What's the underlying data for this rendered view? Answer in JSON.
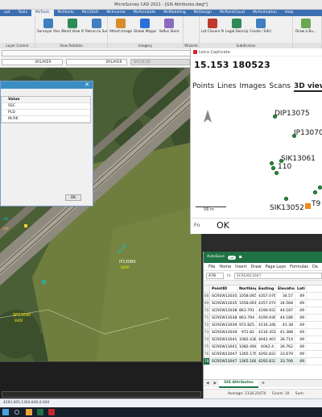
{
  "window": {
    "title": "MicroSurvey CAD 2021 - [GIS Attributes.dwg*]"
  },
  "menu": [
    "out",
    "Tools",
    "MsTools",
    "McPoints",
    "McCOGO",
    "McInverse",
    "McAnnotate",
    "McModeling",
    "McDesign",
    "McPointCloud",
    "McAnimation",
    "Help"
  ],
  "ribbon": {
    "groups": [
      {
        "label": "Layer Control",
        "buttons": []
      },
      {
        "label": "View Rotation",
        "buttons": [
          "Surveyor View",
          "World View (North Up)",
          "Return to Surveyor View"
        ]
      },
      {
        "label": "Imagery",
        "buttons": [
          "Attach Imagery",
          "Global Mapper Auto-Regen",
          "VaRus Store"
        ]
      },
      {
        "label": "Wizards",
        "buttons": []
      },
      {
        "label": "Subdivision",
        "buttons": [
          "Lot Closure Program",
          "Legal Description Writer",
          "Create / Edit Lots Blocks"
        ]
      },
      {
        "label": "",
        "buttons": [
          "Draw a Bu..."
        ]
      }
    ]
  },
  "layerbar": {
    "linetype1": "BYLAYER",
    "linetype2": "BYLAYER",
    "color": "BYCOLOR"
  },
  "dialog": {
    "column_header": "Value",
    "rows": [
      "SSC",
      "PLD",
      "IN RK"
    ],
    "ok_label": "OK"
  },
  "map_labels": [
    {
      "text": "IP13089",
      "sub": "SVOF"
    },
    {
      "text": "SP13090",
      "sub": "SVOF"
    },
    {
      "text": "40.398",
      "sub": ""
    }
  ],
  "leica": {
    "title": "Leica Captivate",
    "position": "15.153 180523",
    "tabs": [
      "Points",
      "Lines",
      "Images",
      "Scans",
      "3D view"
    ],
    "active_tab": "3D view",
    "points": [
      "DIP13075",
      "IP13070",
      "SIK13061",
      "110",
      "SIK13052",
      "T9"
    ],
    "scale_label": "58 m",
    "fn_label": "Fn",
    "ok_label": "OK"
  },
  "excel": {
    "autosave": "AutoSave",
    "autosave_state": "Off",
    "menu": [
      "File",
      "Home",
      "Insert",
      "Draw",
      "Page Layo",
      "Formulas",
      "Da"
    ],
    "cell_ref": "A78",
    "formula_value": "SCREW13047",
    "headers": [
      "PointID",
      "Northing",
      "Easting",
      "Elevation",
      "Lati"
    ],
    "rows": [
      {
        "n": "68",
        "cells": [
          "SCREW13035",
          "1058.065",
          "4357.076",
          "34.57",
          "49"
        ]
      },
      {
        "n": "69",
        "cells": [
          "SCREW13035B",
          "1058.061",
          "4357.074",
          "34.568",
          "49"
        ]
      },
      {
        "n": "70",
        "cells": [
          "SCREW13038",
          "863.791",
          "4190.933",
          "44.187",
          "49"
        ]
      },
      {
        "n": "71",
        "cells": [
          "SCREW13038B",
          "863.794",
          "4190.936",
          "44.186",
          "49"
        ]
      },
      {
        "n": "72",
        "cells": [
          "SCREW13039",
          "972.825",
          "4116.348",
          "41.38",
          "49"
        ]
      },
      {
        "n": "73",
        "cells": [
          "SCREW13039B",
          "972.82",
          "4116.351",
          "41.388",
          "49"
        ]
      },
      {
        "n": "74",
        "cells": [
          "SCREW13041",
          "1082.438",
          "4042.407",
          "36.714",
          "49"
        ]
      },
      {
        "n": "75",
        "cells": [
          "SCREW13041B",
          "1082.494",
          "4042.4",
          "36.762",
          "49"
        ]
      },
      {
        "n": "76",
        "cells": [
          "SCREW13047",
          "1365.176",
          "4292.833",
          "33.679",
          "49"
        ]
      },
      {
        "n": "78",
        "cells": [
          "SCREW13047B",
          "1365.168",
          "4292.833",
          "33.706",
          "49"
        ]
      }
    ],
    "selected_row": "78",
    "sheet_tab": "GIS Attributes",
    "status_average": "Average: 1118.21674",
    "status_count": "Count: 10",
    "status_sum": "Sum:"
  },
  "statusbar": {
    "coords": "4293.005,1364.849,0.000"
  },
  "colors": {
    "ribbon_blue": "#3c6fb0",
    "excel_green": "#1f7244",
    "point_green": "#1e9c3b"
  }
}
